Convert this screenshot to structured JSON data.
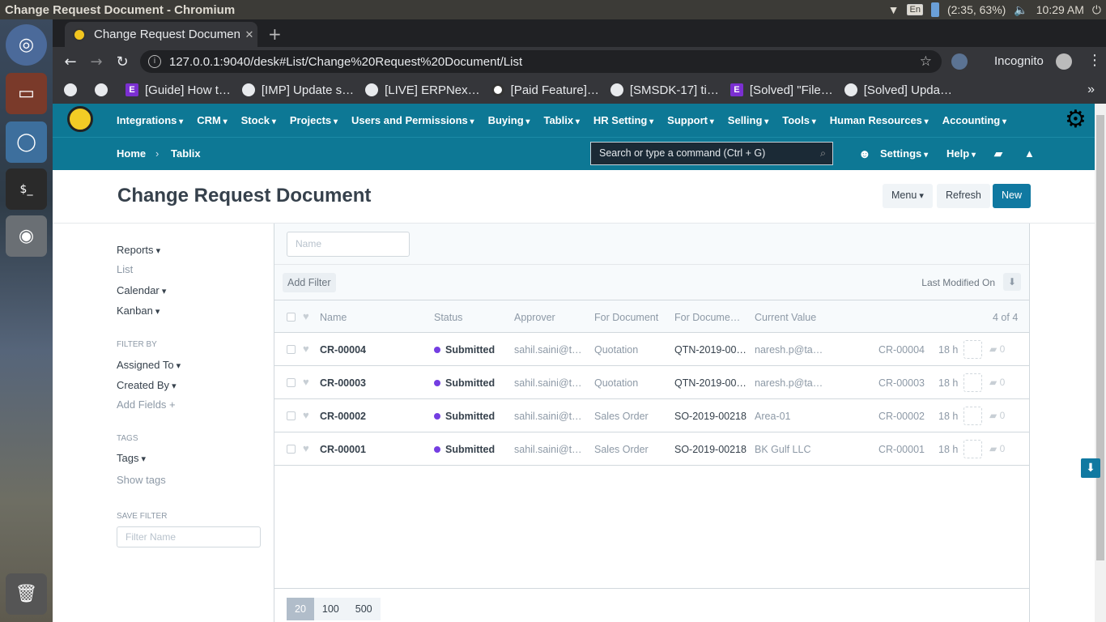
{
  "os": {
    "window_title": "Change Request Document - Chromium",
    "keyboard": "En",
    "battery": "(2:35, 63%)",
    "clock": "10:29 AM"
  },
  "browser": {
    "tab_title": "Change Request Documen",
    "url": "127.0.0.1:9040/desk#List/Change%20Request%20Document/List",
    "incognito_label": "Incognito",
    "bookmarks": [
      {
        "icon": "globe-icon",
        "label": ""
      },
      {
        "icon": "globe-icon",
        "label": ""
      },
      {
        "icon": "e-icon",
        "label": "[Guide] How t…"
      },
      {
        "icon": "globe-icon",
        "label": "[IMP] Update s…"
      },
      {
        "icon": "globe-icon",
        "label": "[LIVE] ERPNex…"
      },
      {
        "icon": "github-icon",
        "label": "[Paid Feature]…"
      },
      {
        "icon": "globe-icon",
        "label": "[SMSDK-17] ti…"
      },
      {
        "icon": "e-icon",
        "label": "[Solved] \"File…"
      },
      {
        "icon": "globe-icon",
        "label": "[Solved] Upda…"
      }
    ]
  },
  "navbar": {
    "menus": [
      "Integrations",
      "CRM",
      "Stock",
      "Projects",
      "Users and Permissions",
      "Buying",
      "Tablix",
      "HR Setting",
      "Support",
      "Selling",
      "Tools",
      "Human Resources",
      "Accounting"
    ],
    "breadcrumb": [
      "Home",
      "Tablix"
    ],
    "search_placeholder": "Search or type a command (Ctrl + G)",
    "settings_label": "Settings",
    "help_label": "Help"
  },
  "page": {
    "title": "Change Request Document",
    "menu_button": "Menu",
    "refresh_button": "Refresh",
    "new_button": "New"
  },
  "sidebar": {
    "reports": "Reports",
    "list": "List",
    "calendar": "Calendar",
    "kanban": "Kanban",
    "filter_by_header": "FILTER BY",
    "assigned_to": "Assigned To",
    "created_by": "Created By",
    "add_fields": "Add Fields",
    "tags_header": "TAGS",
    "tags": "Tags",
    "show_tags": "Show tags",
    "save_filter_header": "SAVE FILTER",
    "filter_name_placeholder": "Filter Name"
  },
  "list": {
    "name_placeholder": "Name",
    "add_filter": "Add Filter",
    "sort_label": "Last Modified On",
    "columns": [
      "Name",
      "Status",
      "Approver",
      "For Document",
      "For Docume…",
      "Current Value"
    ],
    "count": "4 of 4",
    "rows": [
      {
        "name": "CR-00004",
        "status": "Submitted",
        "approver": "sahil.saini@t…",
        "for_document": "Quotation",
        "for_document_name": "QTN-2019-00…",
        "current_value": "naresh.p@ta…",
        "id": "CR-00004",
        "age": "18 h",
        "comments": "0"
      },
      {
        "name": "CR-00003",
        "status": "Submitted",
        "approver": "sahil.saini@t…",
        "for_document": "Quotation",
        "for_document_name": "QTN-2019-00…",
        "current_value": "naresh.p@ta…",
        "id": "CR-00003",
        "age": "18 h",
        "comments": "0"
      },
      {
        "name": "CR-00002",
        "status": "Submitted",
        "approver": "sahil.saini@t…",
        "for_document": "Sales Order",
        "for_document_name": "SO-2019-00218",
        "current_value": "Area-01",
        "id": "CR-00002",
        "age": "18 h",
        "comments": "0"
      },
      {
        "name": "CR-00001",
        "status": "Submitted",
        "approver": "sahil.saini@t…",
        "for_document": "Sales Order",
        "for_document_name": "SO-2019-00218",
        "current_value": "BK Gulf LLC",
        "id": "CR-00001",
        "age": "18 h",
        "comments": "0"
      }
    ],
    "page_sizes": [
      "20",
      "100",
      "500"
    ],
    "selected_page_size": "20",
    "status_color": "#743ee2"
  }
}
